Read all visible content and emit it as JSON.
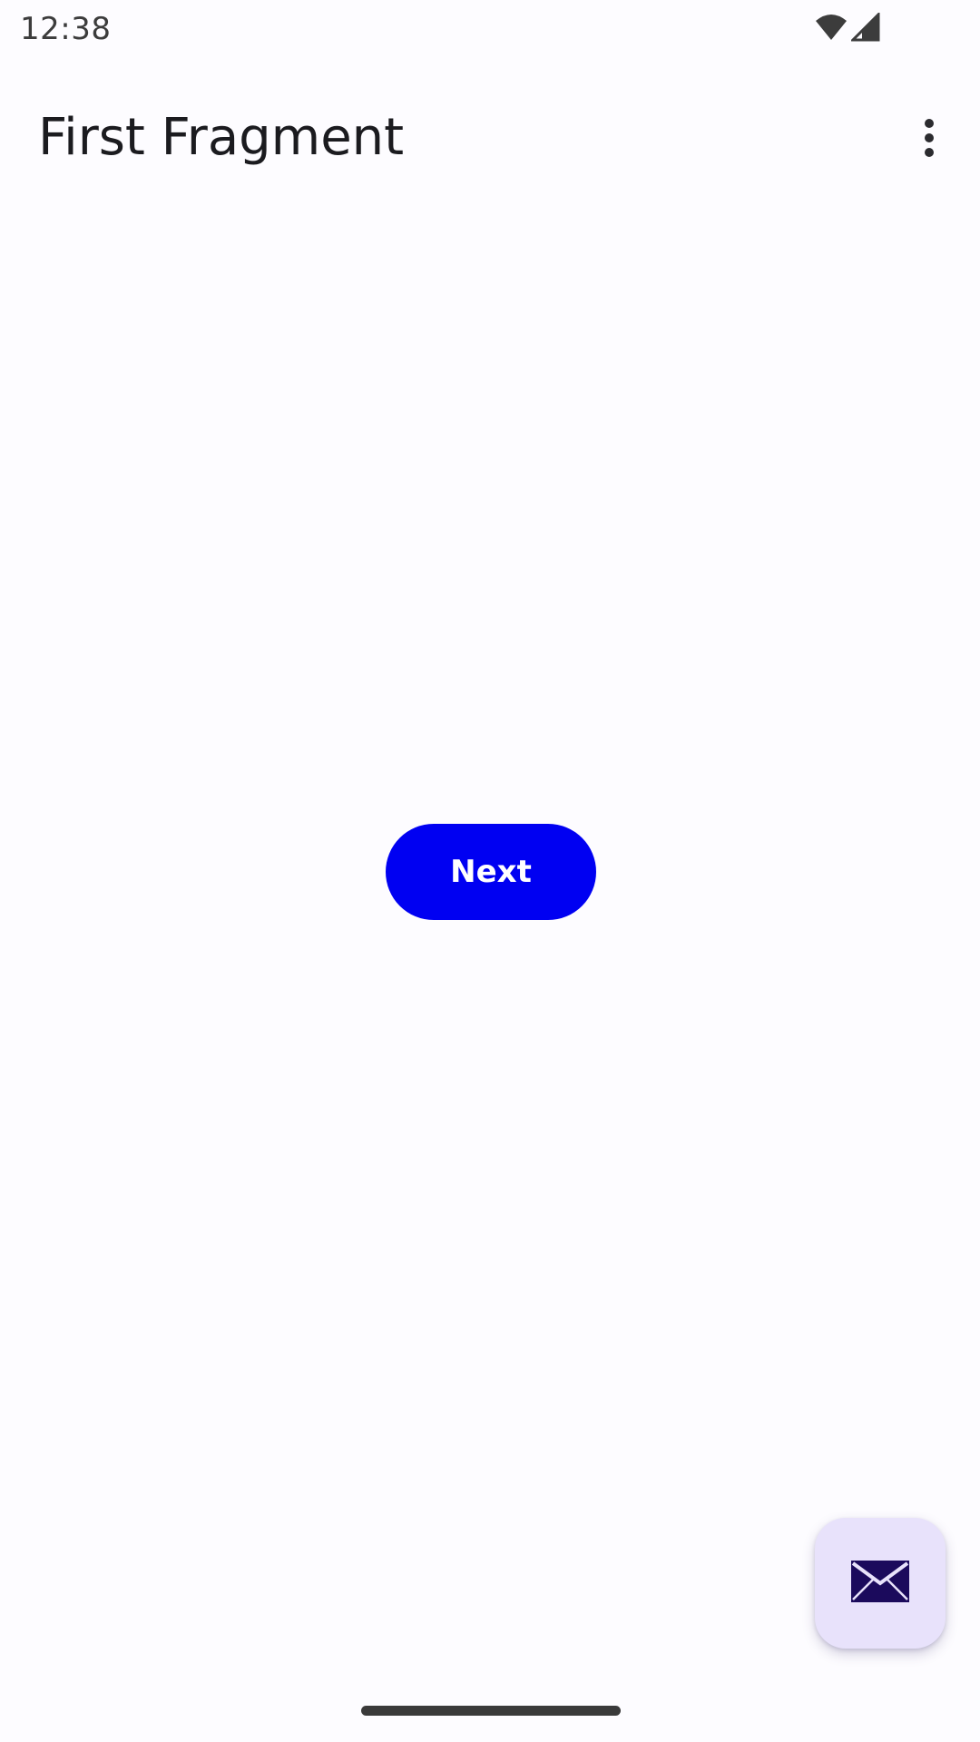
{
  "status_bar": {
    "time": "12:38",
    "icons": [
      "wifi-icon",
      "cell-signal-icon"
    ]
  },
  "app_bar": {
    "title": "First Fragment",
    "overflow_icon": "more-vert-icon"
  },
  "main": {
    "next_button_label": "Next"
  },
  "fab": {
    "icon": "email-icon"
  },
  "colors": {
    "primary": "#0000f2",
    "fab_background": "#e8e2fb",
    "fab_icon": "#1b0a5c",
    "background": "#fdfcff",
    "title_text": "#1b1b1f"
  }
}
